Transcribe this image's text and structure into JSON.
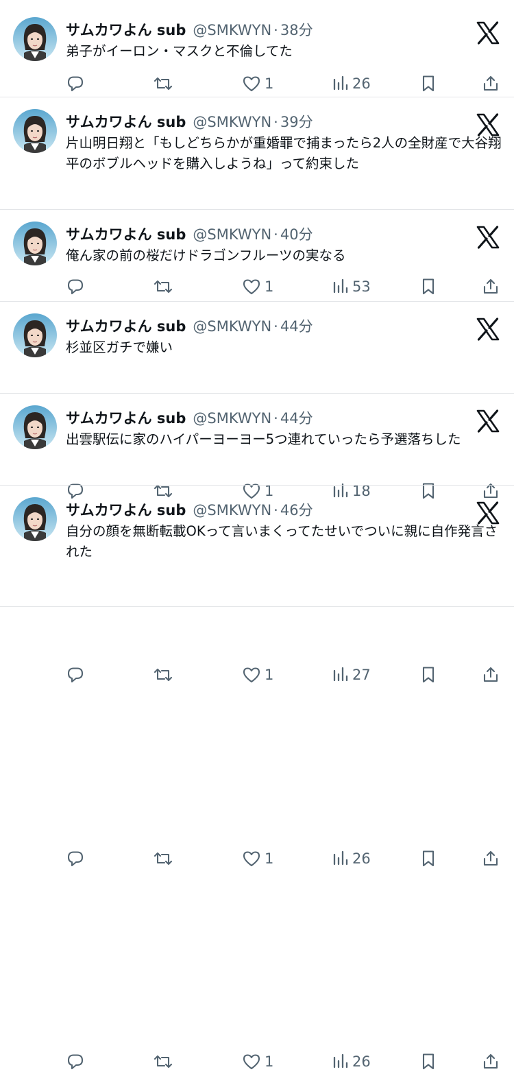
{
  "tweets": [
    {
      "name": "サムカワよん sub",
      "handle": "@SMKWYN",
      "time": "38分",
      "text": "弟子がイーロン・マスクと不倫してた",
      "likes": "1",
      "views": "26"
    },
    {
      "name": "サムカワよん sub",
      "handle": "@SMKWYN",
      "time": "39分",
      "text": "片山明日翔と「もしどちらかが重婚罪で捕まったら2人の全財産で大谷翔平のボブルヘッドを購入しようね」って約束した",
      "likes": "1",
      "views": "53"
    },
    {
      "name": "サムカワよん sub",
      "handle": "@SMKWYN",
      "time": "40分",
      "text": "俺ん家の前の桜だけドラゴンフルーツの実なる",
      "likes": "1",
      "views": "18"
    },
    {
      "name": "サムカワよん sub",
      "handle": "@SMKWYN",
      "time": "44分",
      "text": "杉並区ガチで嫌い",
      "likes": "1",
      "views": "27"
    },
    {
      "name": "サムカワよん sub",
      "handle": "@SMKWYN",
      "time": "44分",
      "text": "出雲駅伝に家のハイパーヨーヨー5つ連れていったら予選落ちした",
      "likes": "1",
      "views": "26"
    },
    {
      "name": "サムカワよん sub",
      "handle": "@SMKWYN",
      "time": "46分",
      "text": "自分の顔を無断転載OKって言いまくってたせいでついに親に自作発言された",
      "likes": "1",
      "views": "26"
    }
  ],
  "separator": "·"
}
